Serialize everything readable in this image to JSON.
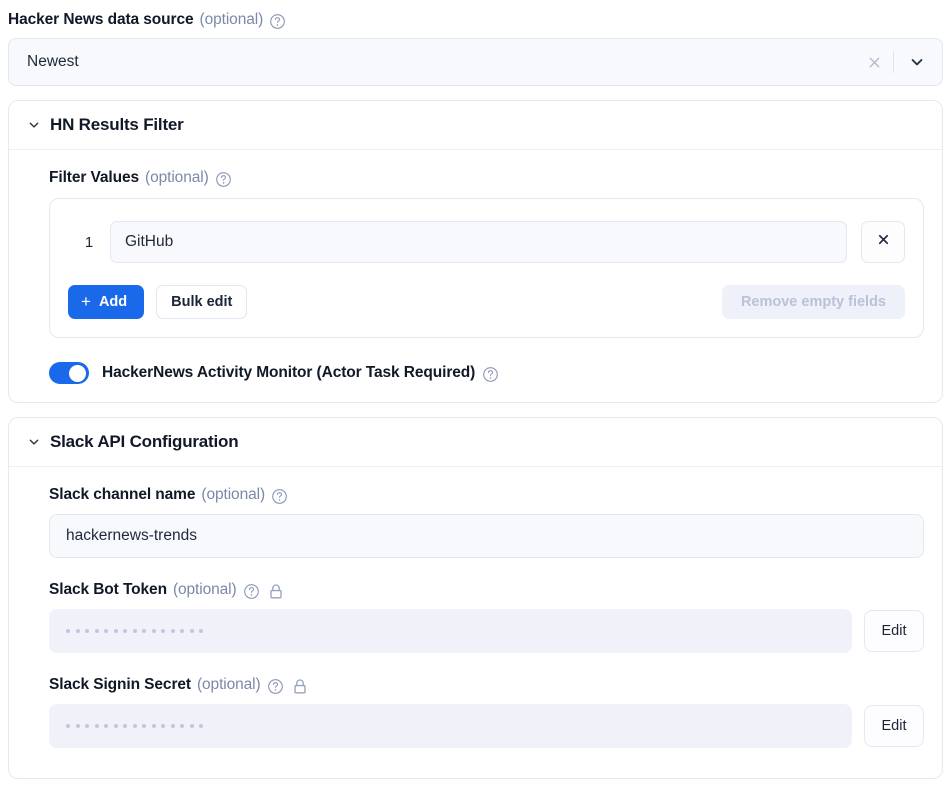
{
  "data_source": {
    "label": "Hacker News data source",
    "optional": "(optional)",
    "help_icon": "help-circle-icon",
    "selected_value": "Newest",
    "clear_icon": "close-icon",
    "caret_icon": "chevron-down-icon"
  },
  "hn_filter_card": {
    "title": "HN Results Filter",
    "collapse_icon": "chevron-down-icon",
    "filter_values": {
      "label": "Filter Values",
      "optional": "(optional)",
      "help_icon": "help-circle-icon",
      "rows": [
        {
          "index": "1",
          "value": "GitHub",
          "delete_icon": "close-icon"
        }
      ],
      "add_button": "Add",
      "add_icon": "plus-icon",
      "bulk_edit_button": "Bulk edit",
      "remove_empty_button": "Remove empty fields"
    },
    "toggle": {
      "label": "HackerNews Activity Monitor (Actor Task Required)",
      "state": "on",
      "help_icon": "help-circle-icon"
    }
  },
  "slack_card": {
    "title": "Slack API Configuration",
    "collapse_icon": "chevron-down-icon",
    "fields": [
      {
        "label": "Slack channel name",
        "optional": "(optional)",
        "help_icon": "help-circle-icon",
        "type": "text",
        "value": "hackernews-trends"
      },
      {
        "label": "Slack Bot Token",
        "optional": "(optional)",
        "help_icon": "help-circle-icon",
        "lock_icon": "lock-icon",
        "type": "secret",
        "masked_dots": 15,
        "edit_button": "Edit"
      },
      {
        "label": "Slack Signin Secret",
        "optional": "(optional)",
        "help_icon": "help-circle-icon",
        "lock_icon": "lock-icon",
        "type": "secret",
        "masked_dots": 15,
        "edit_button": "Edit"
      }
    ]
  },
  "colors": {
    "accent": "#1a69eb",
    "text": "#111827",
    "muted": "#7b88a8",
    "field_bg": "#f7f9fc",
    "secret_bg": "#f1f1fa",
    "border": "#e4e8f1"
  }
}
